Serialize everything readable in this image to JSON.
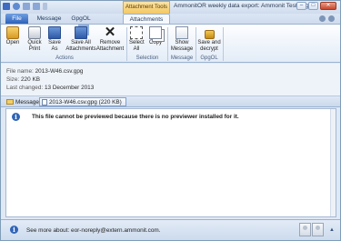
{
  "window": {
    "title": "AmmonitOR weekly data export: Ammonit Test Logger M",
    "contextual_tab_group": "Attachment Tools",
    "controls": {
      "minimize": "–",
      "maximize": "□",
      "close": "✕"
    }
  },
  "tabs": [
    {
      "label": "File"
    },
    {
      "label": "Message"
    },
    {
      "label": "GpgOL"
    },
    {
      "label": "Attachments"
    }
  ],
  "ribbon": {
    "buttons": [
      {
        "label": "Open",
        "icon": "folder-open-icon"
      },
      {
        "label": "Quick Print",
        "icon": "printer-icon"
      },
      {
        "label": "Save As",
        "icon": "save-icon"
      },
      {
        "label": "Save All Attachments",
        "icon": "save-all-icon"
      },
      {
        "label": "Remove Attachment",
        "icon": "remove-x-icon"
      },
      {
        "label": "Select All",
        "icon": "select-all-icon"
      },
      {
        "label": "Copy",
        "icon": "copy-icon"
      },
      {
        "label": "Show Message",
        "icon": "show-message-icon"
      },
      {
        "label": "Save and decrypt",
        "icon": "lock-icon"
      }
    ],
    "groups": [
      {
        "label": "Actions"
      },
      {
        "label": "Selection"
      },
      {
        "label": "Message"
      },
      {
        "label": "GpgOL"
      }
    ]
  },
  "header": {
    "file_name_label": "File name:",
    "file_name": "2013-W46.csv.gpg",
    "size_label": "Size:",
    "size": "220 KB",
    "last_changed_label": "Last changed:",
    "last_changed": "13 December 2013"
  },
  "attachments": {
    "message_tab": "Message",
    "selected": "2013-W46.csv.gpg (220 KB)"
  },
  "preview": {
    "notice": "This file cannot be previewed because there is no previewer installed for it."
  },
  "people_pane": {
    "text": "See more about: eor-noreply@extern.ammonit.com.",
    "expander": "▲"
  },
  "colors": {
    "file_tab": "#2d62bb",
    "contextual_tab": "#f3c862",
    "info_icon": "#2f64b8"
  }
}
